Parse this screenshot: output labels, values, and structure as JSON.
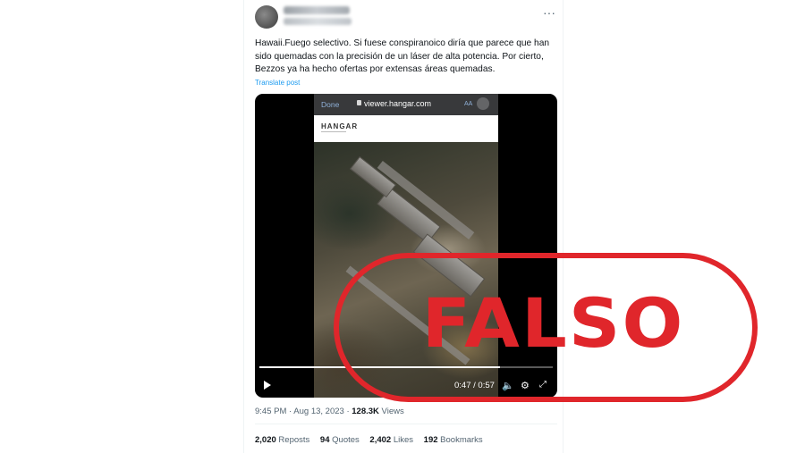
{
  "tweet": {
    "text": "Hawaii.Fuego selectivo. Si fuese conspiranoico diría que parece que han sido quemadas con la precisión de un láser de alta potencia. Por cierto, Bezzos ya ha hecho ofertas por extensas áreas quemadas.",
    "translate_label": "Translate post",
    "more_icon": "more-dots-icon"
  },
  "video": {
    "browser": {
      "done_label": "Done",
      "url": "viewer.hangar.com",
      "aa_label": "AA"
    },
    "site_logo": "HANGAR",
    "progress_fraction": 0.82,
    "time_label": "0:47 / 0:57",
    "icons": [
      "play-icon",
      "volume-icon",
      "gear-icon",
      "fullscreen-icon"
    ]
  },
  "meta": {
    "time_date": "9:45 PM · Aug 13, 2023 ·",
    "views_count": "128.3K",
    "views_label": "Views"
  },
  "stats": {
    "reposts_count": "2,020",
    "reposts_label": "Reposts",
    "quotes_count": "94",
    "quotes_label": "Quotes",
    "likes_count": "2,402",
    "likes_label": "Likes",
    "bookmarks_count": "192",
    "bookmarks_label": "Bookmarks"
  },
  "stamp": {
    "text": "FALSO",
    "color": "#e0262b"
  },
  "colors": {
    "link": "#1d9bf0",
    "secondary_text": "#536471",
    "primary_text": "#0f1419"
  }
}
